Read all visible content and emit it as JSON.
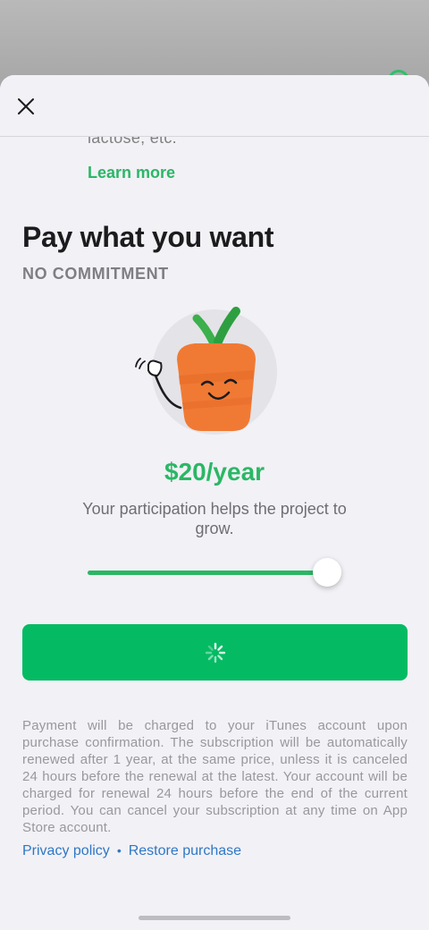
{
  "sheet": {
    "clipped_text": "lactose, etc.",
    "learn_more": "Learn more",
    "title": "Pay what you want",
    "subtitle": "NO COMMITMENT",
    "price": "$20/year",
    "description": "Your participation helps the project to grow.",
    "slider": {
      "value_fraction": 0.96
    },
    "cta": {
      "state": "loading"
    },
    "legal": "Payment will be charged to your iTunes account upon purchase confirmation. The subscription will be automatically renewed after 1 year, at the same price, unless it is canceled 24 hours before the renewal at the latest. Your account will be charged for renewal 24 hours before the end of the current period. You can cancel your subscription at any time on App Store account.",
    "links": {
      "privacy": "Privacy policy",
      "restore": "Restore purchase"
    }
  },
  "colors": {
    "accent": "#04bb63",
    "link": "#2f78c4",
    "carrot": "#f07a34"
  },
  "icons": [
    "close-icon",
    "carrot-mascot-illustration",
    "loading-spinner-icon"
  ]
}
